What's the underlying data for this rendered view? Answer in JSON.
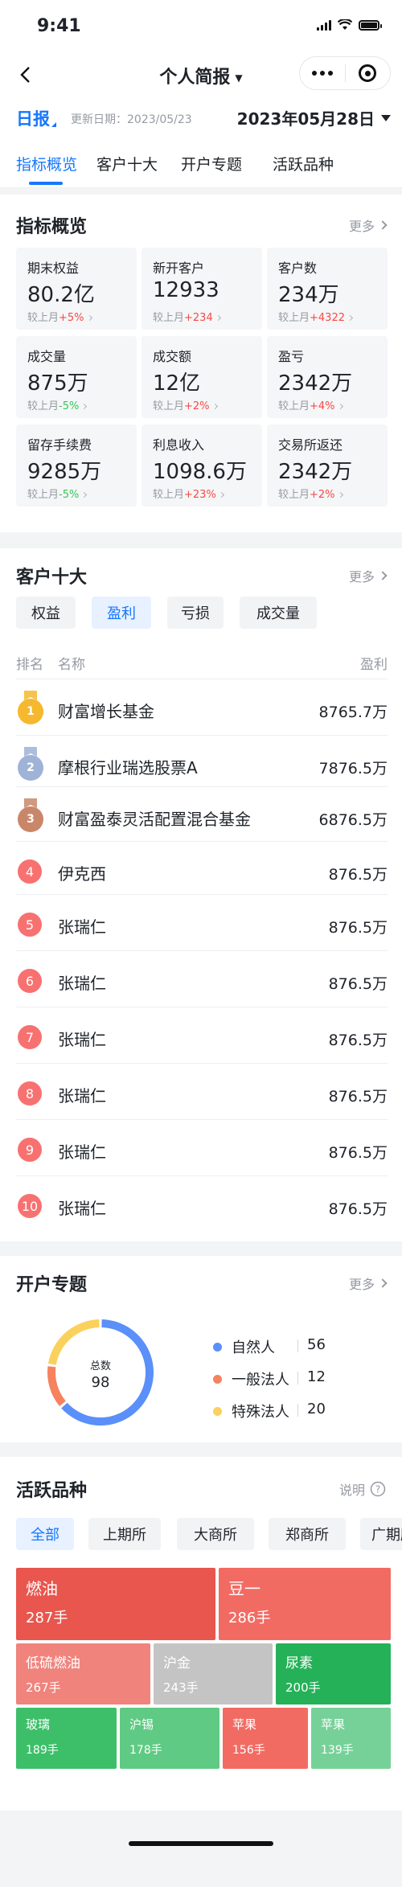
{
  "status_bar": {
    "time": "9:41"
  },
  "nav": {
    "title": "个人简报"
  },
  "date_row": {
    "period": "日报",
    "update_label": "更新日期：2023/05/23",
    "date": "2023年05月28日"
  },
  "tabs": [
    "指标概览",
    "客户十大",
    "开户专题",
    "活跃品种"
  ],
  "overview": {
    "title": "指标概览",
    "more": "更多",
    "compare_label": "较上月",
    "metrics": [
      {
        "label": "期末权益",
        "value": "80.2亿",
        "change": "+5%",
        "dir": "up"
      },
      {
        "label": "新开客户",
        "value": "12933",
        "change": "+234",
        "dir": "up"
      },
      {
        "label": "客户数",
        "value": "234万",
        "change": "+4322",
        "dir": "up"
      },
      {
        "label": "成交量",
        "value": "875万",
        "change": "-5%",
        "dir": "down"
      },
      {
        "label": "成交额",
        "value": "12亿",
        "change": "+2%",
        "dir": "up"
      },
      {
        "label": "盈亏",
        "value": "2342万",
        "change": "+4%",
        "dir": "up"
      },
      {
        "label": "留存手续费",
        "value": "9285万",
        "change": "-5%",
        "dir": "down"
      },
      {
        "label": "利息收入",
        "value": "1098.6万",
        "change": "+23%",
        "dir": "up"
      },
      {
        "label": "交易所返还",
        "value": "2342万",
        "change": "+2%",
        "dir": "up"
      }
    ]
  },
  "top_clients": {
    "title": "客户十大",
    "more": "更多",
    "filters": [
      "权益",
      "盈利",
      "亏损",
      "成交量"
    ],
    "active_filter": "盈利",
    "col_rank": "排名",
    "col_name": "名称",
    "col_value": "盈利",
    "rows": [
      {
        "rank": "1",
        "name": "财富增长基金",
        "value": "8765.7万"
      },
      {
        "rank": "2",
        "name": "摩根行业瑞选股票A",
        "value": "7876.5万"
      },
      {
        "rank": "3",
        "name": "财富盈泰灵活配置混合基金",
        "value": "6876.5万"
      },
      {
        "rank": "4",
        "name": "伊克西",
        "value": "876.5万"
      },
      {
        "rank": "5",
        "name": "张瑞仁",
        "value": "876.5万"
      },
      {
        "rank": "6",
        "name": "张瑞仁",
        "value": "876.5万"
      },
      {
        "rank": "7",
        "name": "张瑞仁",
        "value": "876.5万"
      },
      {
        "rank": "8",
        "name": "张瑞仁",
        "value": "876.5万"
      },
      {
        "rank": "9",
        "name": "张瑞仁",
        "value": "876.5万"
      },
      {
        "rank": "10",
        "name": "张瑞仁",
        "value": "876.5万"
      }
    ],
    "medal_colors": [
      "#f5b82e",
      "#9fb3d6",
      "#c9876a"
    ]
  },
  "accounts": {
    "title": "开户专题",
    "more": "更多",
    "total_label": "总数",
    "total": "98",
    "segments": [
      {
        "name": "自然人",
        "value": 56,
        "color": "#5b8ff9"
      },
      {
        "name": "一般法人",
        "value": 12,
        "color": "#f6825f"
      },
      {
        "name": "特殊法人",
        "value": 20,
        "color": "#fbd15d"
      }
    ]
  },
  "varieties": {
    "title": "活跃品种",
    "help": "说明",
    "exchanges": [
      "全部",
      "上期所",
      "大商所",
      "郑商所",
      "广期所"
    ],
    "active_exchange": "全部",
    "tiles": [
      {
        "name": "燃油",
        "value": "287手",
        "color": "#e8564e"
      },
      {
        "name": "豆一",
        "value": "286手",
        "color": "#f26b63"
      },
      {
        "name": "低硫燃油",
        "value": "267手",
        "color": "#f0837c"
      },
      {
        "name": "沪金",
        "value": "243手",
        "color": "#c4c4c4"
      },
      {
        "name": "尿素",
        "value": "200手",
        "color": "#25b158"
      },
      {
        "name": "玻璃",
        "value": "189手",
        "color": "#3dbf6a"
      },
      {
        "name": "沪锡",
        "value": "178手",
        "color": "#5fca83"
      },
      {
        "name": "苹果",
        "value": "156手",
        "color": "#f26b63"
      },
      {
        "name": "苹果",
        "value": "139手",
        "color": "#76d198"
      }
    ]
  }
}
